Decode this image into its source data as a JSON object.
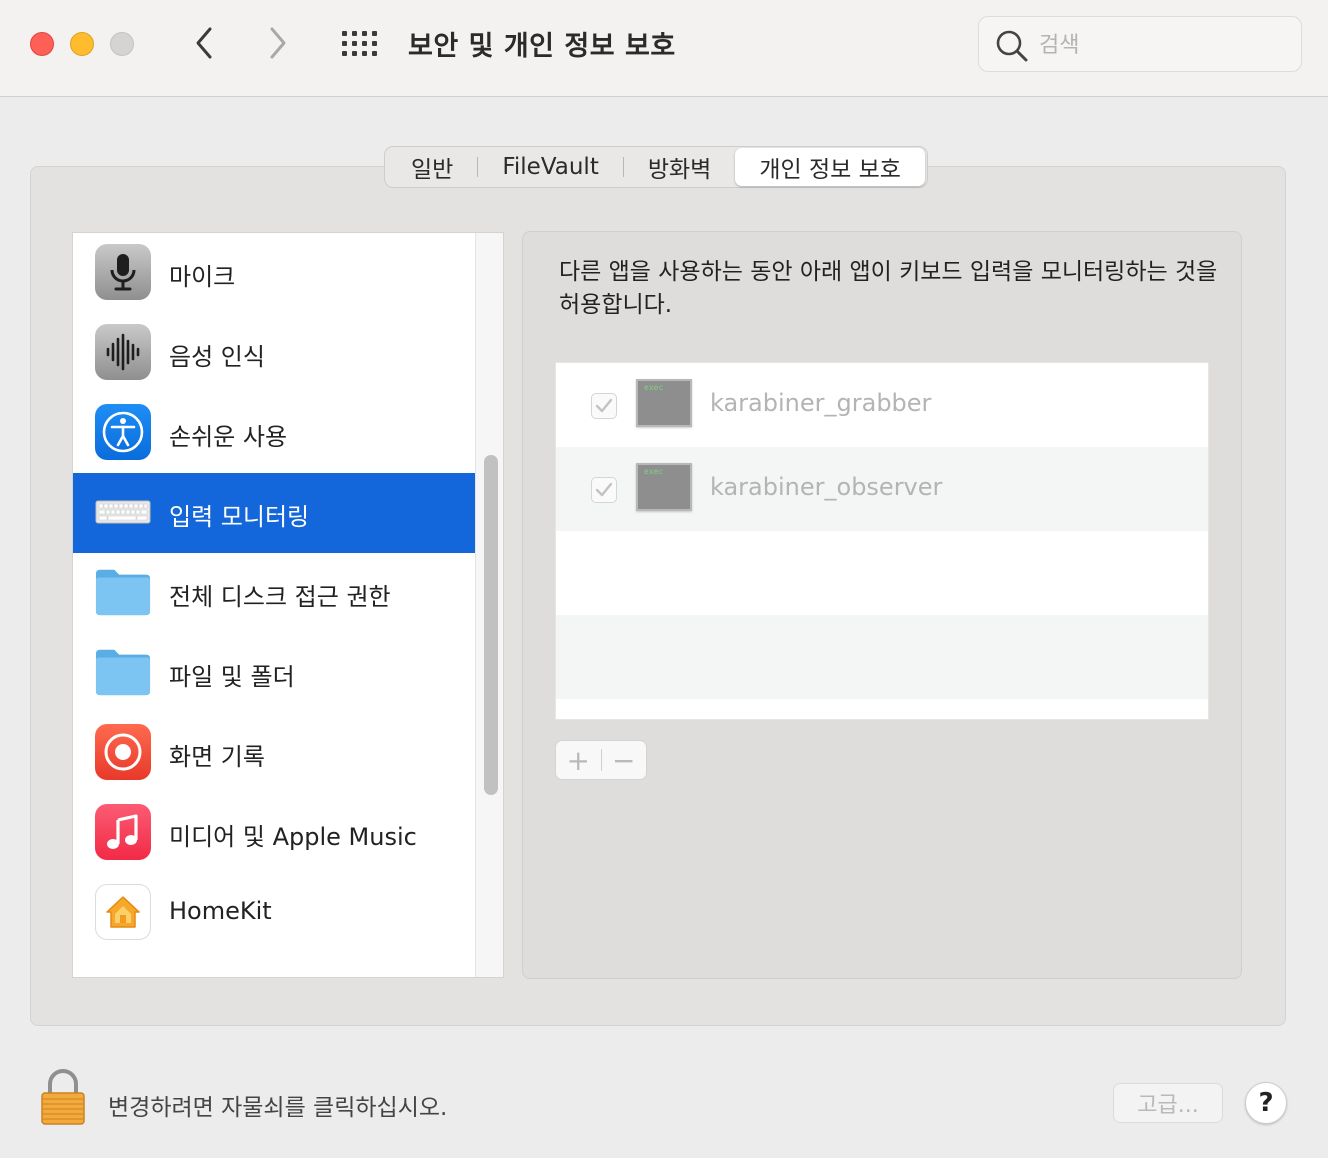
{
  "window": {
    "title": "보안 및 개인 정보 보호"
  },
  "search": {
    "placeholder": "검색",
    "value": ""
  },
  "tabs": [
    {
      "label": "일반",
      "active": false
    },
    {
      "label": "FileVault",
      "active": false
    },
    {
      "label": "방화벽",
      "active": false
    },
    {
      "label": "개인 정보 보호",
      "active": true
    }
  ],
  "sidebar": {
    "items": [
      {
        "label": "마이크",
        "icon": "microphone-icon",
        "selected": false
      },
      {
        "label": "음성 인식",
        "icon": "speech-recognition-icon",
        "selected": false
      },
      {
        "label": "손쉬운 사용",
        "icon": "accessibility-icon",
        "selected": false
      },
      {
        "label": "입력 모니터링",
        "icon": "keyboard-icon",
        "selected": true
      },
      {
        "label": "전체 디스크 접근 권한",
        "icon": "folder-icon",
        "selected": false
      },
      {
        "label": "파일 및 폴더",
        "icon": "folder-icon",
        "selected": false
      },
      {
        "label": "화면 기록",
        "icon": "screen-recording-icon",
        "selected": false
      },
      {
        "label": "미디어 및 Apple Music",
        "icon": "music-icon",
        "selected": false
      },
      {
        "label": "HomeKit",
        "icon": "home-icon",
        "selected": false
      }
    ]
  },
  "detail": {
    "description": "다른 앱을 사용하는 동안 아래 앱이 키보드 입력을 모니터링하는 것을 허용합니다.",
    "apps": [
      {
        "name": "karabiner_grabber",
        "checked": true,
        "icon_text": "exec"
      },
      {
        "name": "karabiner_observer",
        "checked": true,
        "icon_text": "exec"
      }
    ],
    "add_label": "+",
    "remove_label": "−"
  },
  "footer": {
    "lock_text": "변경하려면 자물쇠를 클릭하십시오.",
    "advanced_label": "고급...",
    "help_label": "?"
  },
  "colors": {
    "selection": "#1467db",
    "close": "#fe5f57",
    "minimize": "#febc2e"
  }
}
